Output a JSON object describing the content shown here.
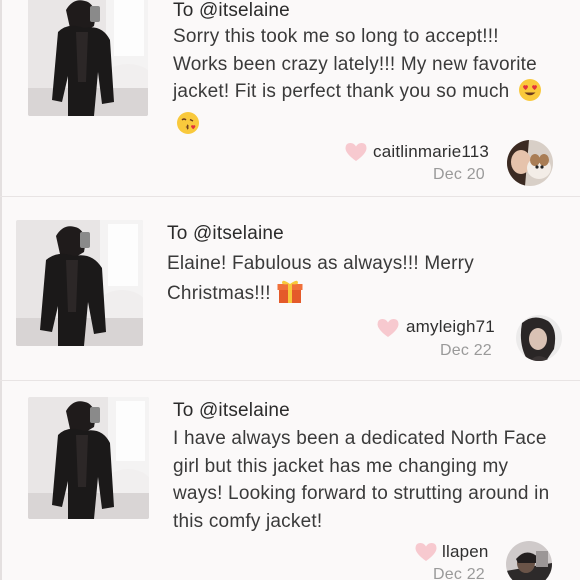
{
  "comments": [
    {
      "to": "To @itselaine",
      "message": "Sorry this took me so long to accept!!! Works been crazy lately!!! My new favorite jacket! Fit is perfect thank you so much",
      "emojis": [
        "heart-eyes-emoji",
        "kissing-heart-emoji"
      ],
      "username": "caitlinmarie113",
      "date": "Dec 20"
    },
    {
      "to": "To @itselaine",
      "message": "Elaine! Fabulous as always!!! Merry Christmas!!!",
      "emojis": [
        "wrapped-gift-emoji"
      ],
      "username": "amyleigh71",
      "date": "Dec 22"
    },
    {
      "to": "To @itselaine",
      "message": "I have always been a dedicated North Face girl but this jacket has me changing my ways! Looking forward to strutting around in this comfy jacket!",
      "emojis": [],
      "username": "llapen",
      "date": "Dec 22"
    }
  ],
  "colors": {
    "background": "#fbf9f9",
    "heart": "#f7c9cf",
    "text": "#3a3a3a",
    "date": "#9a9a9a"
  }
}
